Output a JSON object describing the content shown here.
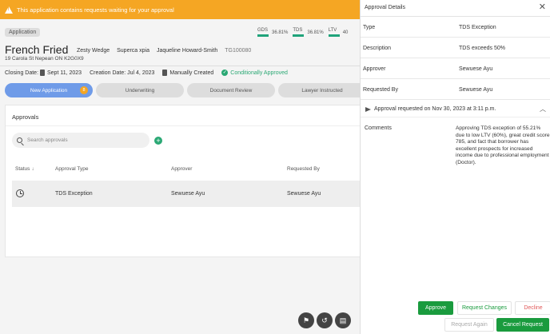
{
  "banner": {
    "text": "This application contains requests waiting for your approval"
  },
  "app": {
    "chip": "Application",
    "client_name": "French Fried",
    "co_borrowers": [
      "Zesty Wedge",
      "Superca xpia",
      "Jaqueline Howard-Smith"
    ],
    "ref_id": "TG100080",
    "address": "19 Carola St Nepean ON K2G0X9",
    "metrics": [
      {
        "label": "GDS",
        "value": "36.81%"
      },
      {
        "label": "TDS",
        "value": "36.81%"
      },
      {
        "label": "LTV",
        "value": "40"
      }
    ],
    "closing_date": "Closing Date:",
    "closing_date_value": "Sept 11, 2023",
    "creation_date": "Creation Date: Jul 4, 2023",
    "created_type": "Manually Created",
    "status": "Conditionally Approved"
  },
  "tabs": [
    {
      "label": "New Application",
      "badge": "8",
      "active": true
    },
    {
      "label": "Underwriting"
    },
    {
      "label": "Document Review"
    },
    {
      "label": "Lawyer Instructed"
    }
  ],
  "approvals": {
    "title": "Approvals",
    "search_placeholder": "Search approvals",
    "add_label": "+",
    "columns": {
      "status": "Status",
      "type": "Approval Type",
      "approver": "Approver",
      "requested_by": "Requested By"
    },
    "rows": [
      {
        "type": "TDS Exception",
        "approver": "Sewuese Ayu",
        "requested_by": "Sewuese Ayu"
      }
    ]
  },
  "panel": {
    "title": "Approval Details",
    "details": [
      {
        "label": "Type",
        "value": "TDS Exception"
      },
      {
        "label": "Description",
        "value": "TDS exceeds 50%"
      },
      {
        "label": "Approver",
        "value": "Sewuese Ayu"
      },
      {
        "label": "Requested By",
        "value": "Sewuese Ayu"
      }
    ],
    "request_line": "Approval requested on Nov 30, 2023 at 3:11 p.m.",
    "comments_label": "Comments",
    "comments_text": "Approving TDS exception of 55.21% due to low LTV (60%), great credit score 785, and fact that borrower has excellent prospects for increased income due to professional employment (Doctor).",
    "buttons": {
      "approve": "Approve",
      "request_changes": "Request Changes",
      "decline": "Decline",
      "request_again": "Request Again",
      "cancel_request": "Cancel Request"
    }
  },
  "icons": {
    "fab1": "flag-icon",
    "fab2": "history-icon",
    "fab3": "document-icon"
  }
}
